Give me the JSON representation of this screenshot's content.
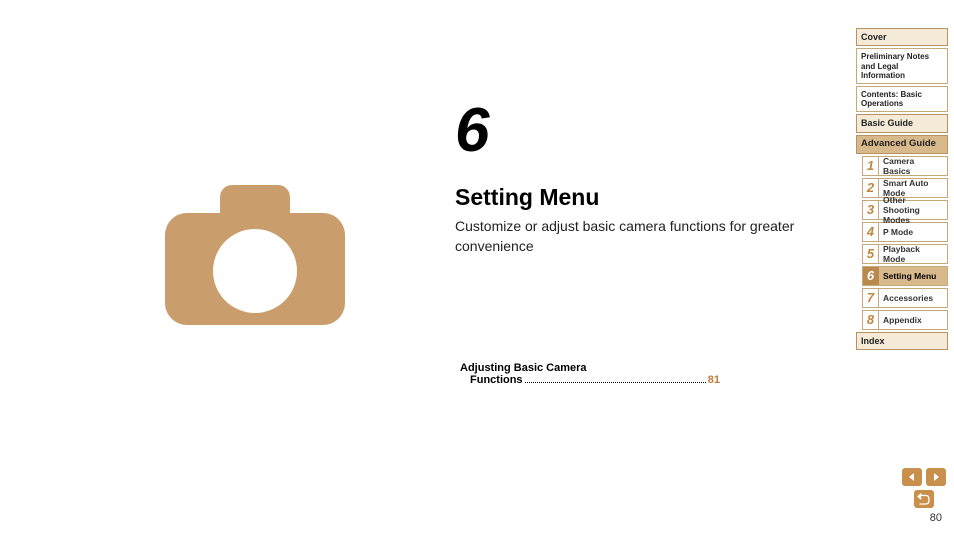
{
  "chapter": {
    "number": "6",
    "title": "Setting Menu",
    "subtitle": "Customize or adjust basic camera functions for greater convenience"
  },
  "toc": {
    "label_line1": "Adjusting Basic Camera",
    "label_line2": "Functions",
    "page": "81"
  },
  "sidebar": {
    "cover": "Cover",
    "preliminary": "Preliminary Notes and Legal Information",
    "contents": "Contents: Basic Operations",
    "basic_guide": "Basic Guide",
    "advanced_guide": "Advanced Guide",
    "chapters": [
      {
        "num": "1",
        "label": "Camera Basics",
        "active": false
      },
      {
        "num": "2",
        "label": "Smart Auto Mode",
        "active": false
      },
      {
        "num": "3",
        "label": "Other Shooting Modes",
        "active": false
      },
      {
        "num": "4",
        "label": "P Mode",
        "active": false
      },
      {
        "num": "5",
        "label": "Playback Mode",
        "active": false
      },
      {
        "num": "6",
        "label": "Setting Menu",
        "active": true
      },
      {
        "num": "7",
        "label": "Accessories",
        "active": false
      },
      {
        "num": "8",
        "label": "Appendix",
        "active": false
      }
    ],
    "index": "Index"
  },
  "footer": {
    "page_number": "80"
  },
  "icons": {
    "camera": "camera-icon",
    "prev": "prev-page-icon",
    "next": "next-page-icon",
    "return": "return-icon"
  },
  "colors": {
    "accent": "#c98f4d",
    "sidebar_bg": "#f5e9d7",
    "sidebar_heading": "#d8b98c",
    "toc_page": "#c77a3a"
  }
}
